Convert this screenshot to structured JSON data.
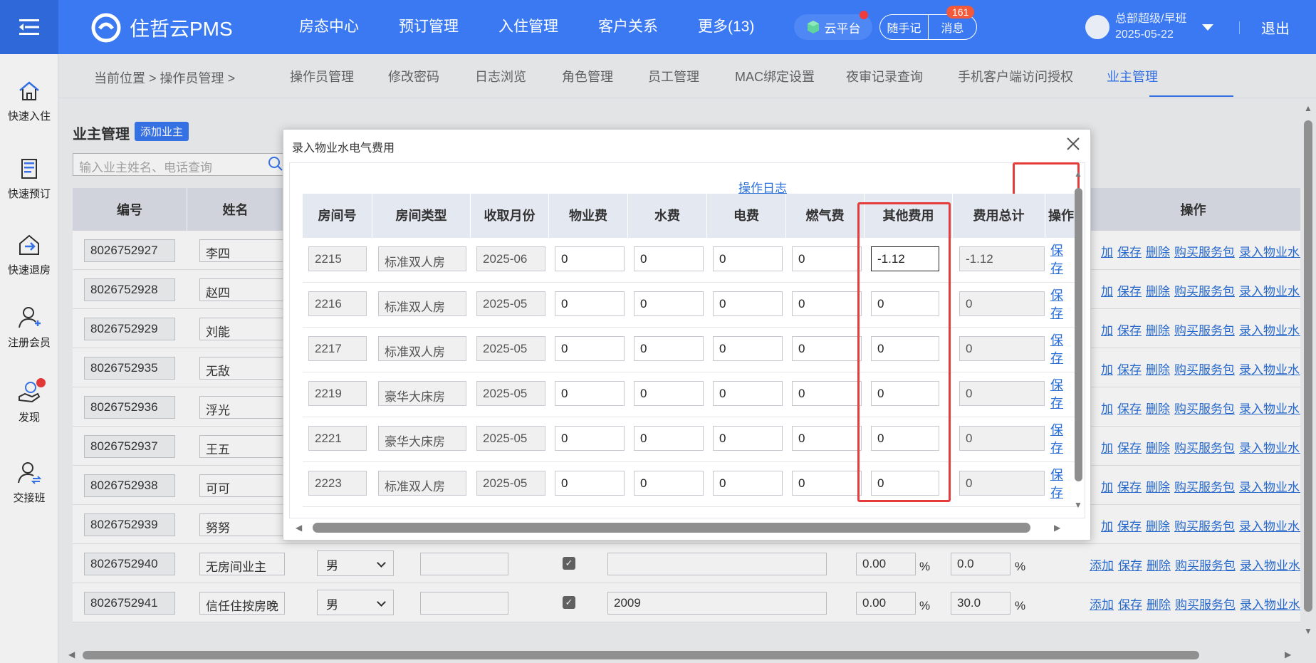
{
  "topbar": {
    "brand": "住哲云PMS",
    "nav": [
      "房态中心",
      "预订管理",
      "入住管理",
      "客户关系",
      "更多(13)"
    ],
    "cloud_platform": "云平台",
    "notes": "随手记",
    "messages": "消息",
    "message_count": "161",
    "user_name": "总部超级/早班",
    "user_date": "2025-05-22",
    "logout": "退出",
    "colors": {
      "primary": "#3a79f2",
      "danger": "#e63b3b"
    }
  },
  "sidebar": [
    {
      "label": "快速入住",
      "icon": "home-icon"
    },
    {
      "label": "快速预订",
      "icon": "document-icon"
    },
    {
      "label": "快速退房",
      "icon": "checkout-icon"
    },
    {
      "label": "注册会员",
      "icon": "add-user-icon"
    },
    {
      "label": "发现",
      "icon": "discover-icon"
    },
    {
      "label": "交接班",
      "icon": "shift-handover-icon"
    }
  ],
  "breadcrumb": {
    "current_position": "当前位置",
    "separator": ">",
    "section": "操作员管理"
  },
  "tabs": [
    "操作员管理",
    "修改密码",
    "日志浏览",
    "角色管理",
    "员工管理",
    "MAC绑定设置",
    "夜审记录查询",
    "手机客户端访问授权",
    "业主管理"
  ],
  "active_tab": "业主管理",
  "page": {
    "title": "业主管理",
    "add_button": "添加业主",
    "search_placeholder": "输入业主姓名、电话查询",
    "columns": {
      "id": "编号",
      "name": "姓名",
      "ops": "操作"
    },
    "op_links": [
      "添加",
      "保存",
      "删除",
      "购买服务包",
      "录入物业水电"
    ],
    "rows": [
      {
        "id": "8026752927",
        "name": "李四"
      },
      {
        "id": "8026752928",
        "name": "赵四"
      },
      {
        "id": "8026752929",
        "name": "刘能"
      },
      {
        "id": "8026752935",
        "name": "无敌"
      },
      {
        "id": "8026752936",
        "name": "浮光"
      },
      {
        "id": "8026752937",
        "name": "王五"
      },
      {
        "id": "8026752938",
        "name": "可可"
      },
      {
        "id": "8026752939",
        "name": "努努"
      },
      {
        "id": "8026752940",
        "name": "无房间业主",
        "gender": "男",
        "note": "",
        "pct1": "0.00",
        "pct2": "0.0"
      },
      {
        "id": "8026752941",
        "name": "信任住按房晚",
        "gender": "男",
        "note": "2009",
        "pct1": "0.00",
        "pct2": "30.0"
      }
    ],
    "percent_sign": "%"
  },
  "modal": {
    "title": "录入物业水电气费用",
    "operation_log": "操作日志",
    "headers": [
      "房间号",
      "房间类型",
      "收取月份",
      "物业费",
      "水费",
      "电费",
      "燃气费",
      "其他费用",
      "费用总计",
      "操作"
    ],
    "save_label": "保存",
    "rows": [
      {
        "room": "2215",
        "type": "标准双人房",
        "month": "2025-06",
        "property": "0",
        "water": "0",
        "electric": "0",
        "gas": "0",
        "other": "-1.12",
        "total": "-1.12"
      },
      {
        "room": "2216",
        "type": "标准双人房",
        "month": "2025-05",
        "property": "0",
        "water": "0",
        "electric": "0",
        "gas": "0",
        "other": "0",
        "total": "0"
      },
      {
        "room": "2217",
        "type": "标准双人房",
        "month": "2025-05",
        "property": "0",
        "water": "0",
        "electric": "0",
        "gas": "0",
        "other": "0",
        "total": "0"
      },
      {
        "room": "2219",
        "type": "豪华大床房",
        "month": "2025-05",
        "property": "0",
        "water": "0",
        "electric": "0",
        "gas": "0",
        "other": "0",
        "total": "0"
      },
      {
        "room": "2221",
        "type": "豪华大床房",
        "month": "2025-05",
        "property": "0",
        "water": "0",
        "electric": "0",
        "gas": "0",
        "other": "0",
        "total": "0"
      },
      {
        "room": "2223",
        "type": "标准双人房",
        "month": "2025-05",
        "property": "0",
        "water": "0",
        "electric": "0",
        "gas": "0",
        "other": "0",
        "total": "0"
      }
    ]
  }
}
